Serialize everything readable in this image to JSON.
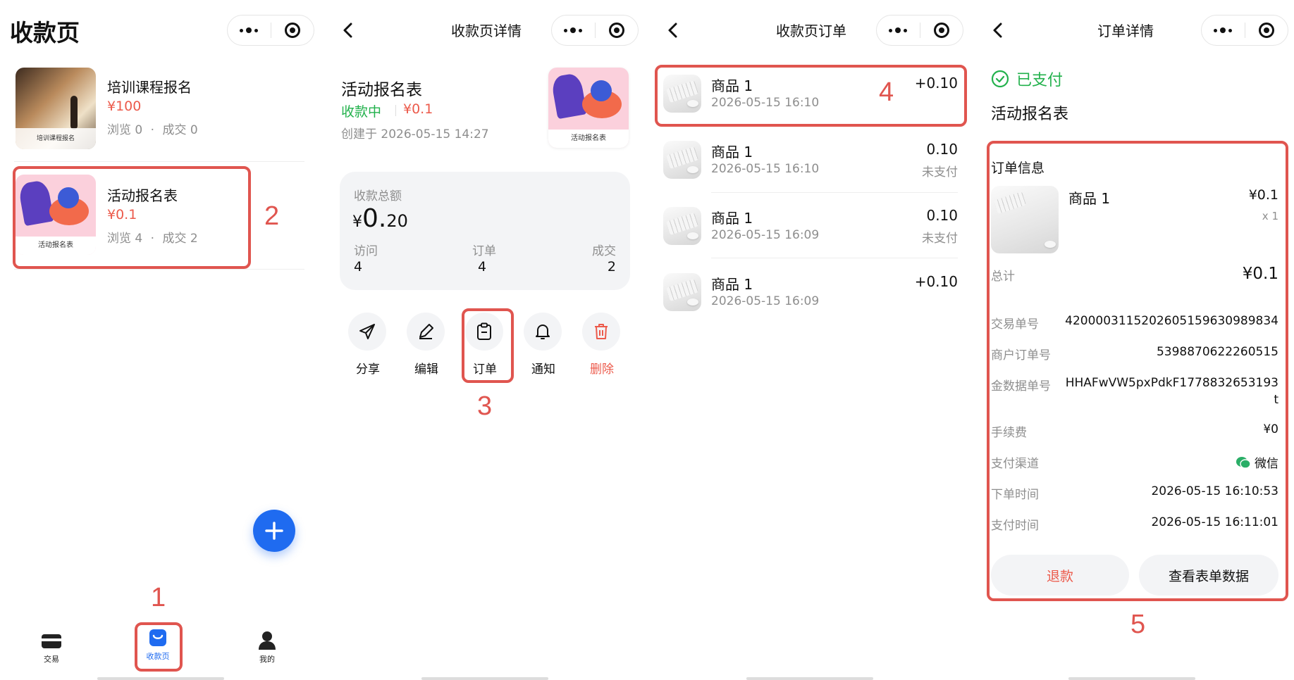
{
  "panel1": {
    "title": "收款页",
    "items": [
      {
        "name": "培训课程报名",
        "price": "¥100",
        "stats_views": "浏览 0",
        "stats_deals": "成交 0",
        "thumb_caption": "培训课程报名",
        "dot": "·"
      },
      {
        "name": "活动报名表",
        "price": "¥0.1",
        "stats_views": "浏览 4",
        "stats_deals": "成交 2",
        "thumb_caption": "活动报名表",
        "dot": "·"
      }
    ],
    "tabbar": [
      {
        "label": "交易",
        "icon": "card-icon"
      },
      {
        "label": "收款页",
        "icon": "bag-icon",
        "active": true
      },
      {
        "label": "我的",
        "icon": "person-icon"
      }
    ],
    "fab_icon": "plus-icon",
    "accent": "#1f6bf0"
  },
  "panel2": {
    "title": "收款页详情",
    "page_name": "活动报名表",
    "status": "收款中",
    "price": "¥0.1",
    "created": "创建于 2026-05-15 14:27",
    "thumb_caption": "活动报名表",
    "summary": {
      "label": "收款总额",
      "currency": "¥",
      "amount_int": "0.",
      "amount_dec": "20",
      "stats": [
        {
          "label": "访问",
          "value": "4"
        },
        {
          "label": "订单",
          "value": "4"
        },
        {
          "label": "成交",
          "value": "2"
        }
      ]
    },
    "actions": [
      {
        "label": "分享",
        "icon": "send-icon"
      },
      {
        "label": "编辑",
        "icon": "pencil-icon"
      },
      {
        "label": "订单",
        "icon": "clipboard-icon"
      },
      {
        "label": "通知",
        "icon": "bell-icon"
      },
      {
        "label": "删除",
        "icon": "trash-icon",
        "danger": true
      }
    ],
    "status_color": "#22b14c",
    "danger_color": "#ec5a4b"
  },
  "panel3": {
    "title": "收款页订单",
    "orders": [
      {
        "name": "商品 1",
        "time": "2026-05-15 16:10",
        "amount": "+0.10",
        "status": ""
      },
      {
        "name": "商品 1",
        "time": "2026-05-15 16:10",
        "amount": "0.10",
        "status": "未支付"
      },
      {
        "name": "商品 1",
        "time": "2026-05-15 16:09",
        "amount": "0.10",
        "status": "未支付"
      },
      {
        "name": "商品 1",
        "time": "2026-05-15 16:09",
        "amount": "+0.10",
        "status": ""
      }
    ]
  },
  "panel4": {
    "title": "订单详情",
    "status": "已支付",
    "page_name": "活动报名表",
    "section_title": "订单信息",
    "product": {
      "name": "商品 1",
      "price": "¥0.1",
      "qty": "x 1"
    },
    "total_label": "总计",
    "total_value": "¥0.1",
    "rows": [
      {
        "label": "交易单号",
        "value": "4200003115202605159630989834"
      },
      {
        "label": "商户订单号",
        "value": "5398870622260515"
      },
      {
        "label": "金数据单号",
        "value": "HHAFwVW5pxPdkF1778832653193",
        "value_line2": "t"
      },
      {
        "label": "手续费",
        "value": "¥0"
      },
      {
        "label": "支付渠道",
        "value": "微信",
        "icon": "wechat-icon"
      },
      {
        "label": "下单时间",
        "value": "2026-05-15 16:10:53"
      },
      {
        "label": "支付时间",
        "value": "2026-05-15 16:11:01"
      }
    ],
    "refund_label": "退款",
    "view_form_label": "查看表单数据",
    "paid_color": "#22b14c",
    "wechat_color": "#2aae67"
  },
  "annotations": [
    "1",
    "2",
    "3",
    "4",
    "5"
  ],
  "annotation_color": "#e0554f"
}
